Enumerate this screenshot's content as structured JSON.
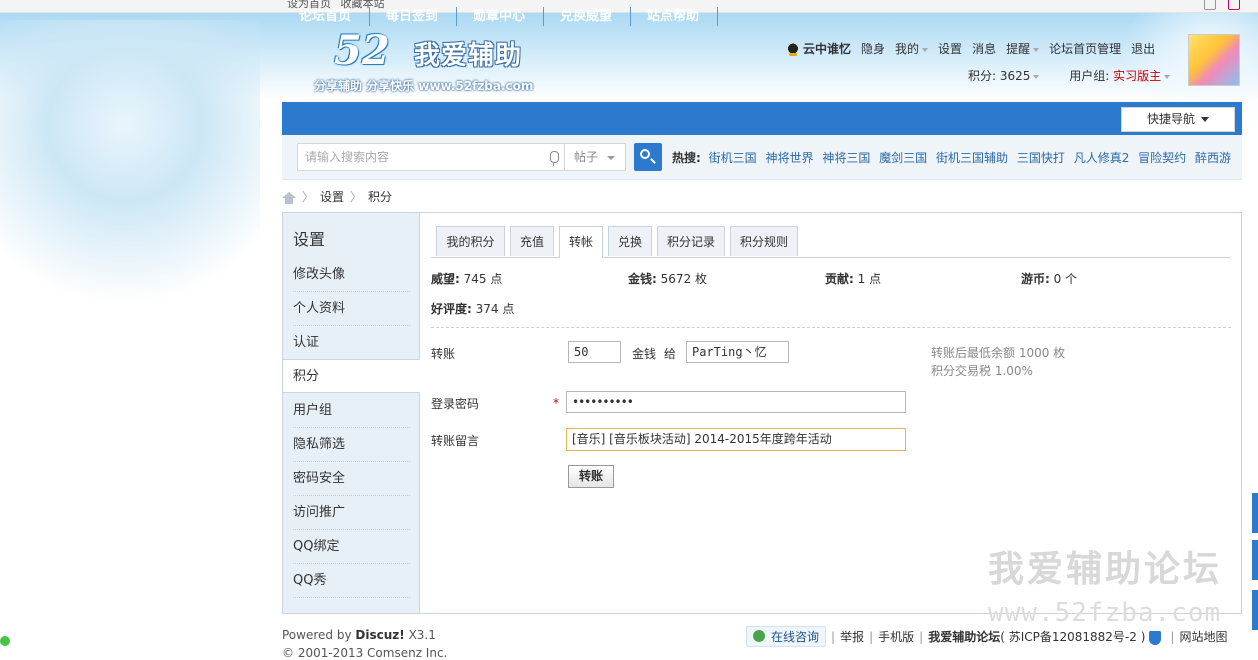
{
  "topbar": {
    "links": [
      "设为首页",
      "收藏本站"
    ]
  },
  "logo": {
    "number": "52",
    "name": "我爱辅助",
    "slogan": "分享辅助 分享快乐 www.52fzba.com"
  },
  "user": {
    "name": "云中谁忆",
    "links": [
      "隐身",
      "我的",
      "设置",
      "消息",
      "提醒",
      "论坛首页管理",
      "退出"
    ],
    "points_text": "积分: 3625",
    "group_label": "用户组:",
    "group": "实习版主"
  },
  "nav": {
    "items": [
      "论坛首页",
      "每日签到",
      "勋章中心",
      "兑换威望",
      "站点帮助"
    ],
    "quick_nav": "快捷导航"
  },
  "search": {
    "placeholder": "请输入搜索内容",
    "scope": "帖子",
    "hot_label": "热搜:",
    "hot_items": [
      "街机三国",
      "神将世界",
      "神将三国",
      "魔剑三国",
      "街机三国辅助",
      "三国快打",
      "凡人修真2",
      "冒险契约",
      "醉西游"
    ]
  },
  "breadcrumb": [
    "设置",
    "积分"
  ],
  "sidebar": {
    "title": "设置",
    "items": [
      "修改头像",
      "个人资料",
      "认证",
      "积分",
      "用户组",
      "隐私筛选",
      "密码安全",
      "访问推广",
      "QQ绑定",
      "QQ秀"
    ],
    "active_index": 3
  },
  "tabs": {
    "items": [
      "我的积分",
      "充值",
      "转帐",
      "兑换",
      "积分记录",
      "积分规则"
    ],
    "active_index": 2
  },
  "stats": [
    {
      "label": "威望:",
      "value": "745 点"
    },
    {
      "label": "金钱:",
      "value": "5672 枚"
    },
    {
      "label": "贡献:",
      "value": "1 点"
    },
    {
      "label": "游币:",
      "value": "0 个"
    },
    {
      "label": "好评度:",
      "value": "374 点"
    }
  ],
  "form": {
    "transfer_label": "转账",
    "amount": "50",
    "unit": "金钱",
    "to_label": "给",
    "recipient": "ParTing丶忆",
    "hint1": "转账后最低余额 1000 枚",
    "hint2": "积分交易税 1.00%",
    "password_label": "登录密码",
    "required_mark": "*",
    "password_mask": "••••••••••",
    "message_label": "转账留言",
    "message": "[音乐] [音乐板块活动] 2014-2015年度跨年活动",
    "submit": "转账"
  },
  "watermark": {
    "line1": "我爱辅助论坛",
    "line2": "www.52fzba.com"
  },
  "footer": {
    "powered_prefix": "Powered by",
    "powered_brand": "Discuz!",
    "powered_version": "X3.1",
    "copyright": "© 2001-2013 Comsenz Inc.",
    "consult": "在线咨询",
    "links": [
      "举报",
      "手机版"
    ],
    "site": "我爱辅助论坛",
    "icp": "( 苏ICP备12081882号-2 )",
    "sitemap": "网站地图"
  },
  "colors": {
    "nav_bg": "#2b7acd",
    "group_color": "#cc0000",
    "side_bg": "#e8f0f7"
  }
}
